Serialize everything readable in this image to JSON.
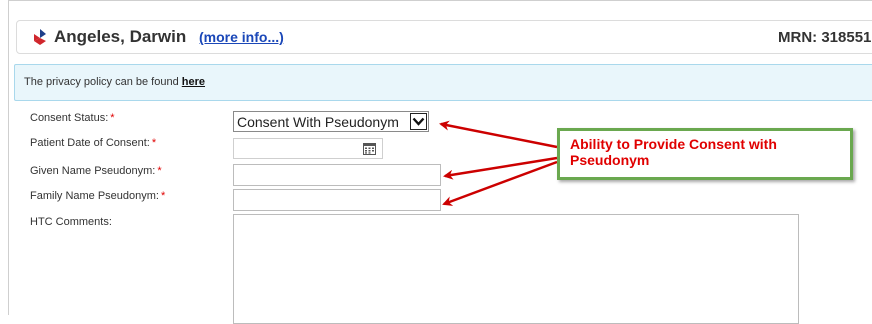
{
  "patient": {
    "name": "Angeles, Darwin",
    "more_info": "(more info...)",
    "mrn": "MRN: 318551"
  },
  "privacy": {
    "text": "The privacy policy can be found ",
    "link": "here"
  },
  "form": {
    "consent_status_label": "Consent Status:",
    "consent_status_value": "Consent With Pseudonym",
    "date_label": "Patient Date of Consent:",
    "given_label": "Given Name Pseudonym:",
    "family_label": "Family Name Pseudonym:",
    "comments_label": "HTC Comments:",
    "required_mark": "*"
  },
  "callout": {
    "text": "Ability to Provide Consent with Pseudonym"
  },
  "colors": {
    "annotation_red": "#cc0000",
    "callout_border": "#6aa84f",
    "link_blue": "#1a47b8"
  },
  "icons": [
    "brand-logo-icon",
    "chevron-down-icon",
    "calendar-icon"
  ]
}
